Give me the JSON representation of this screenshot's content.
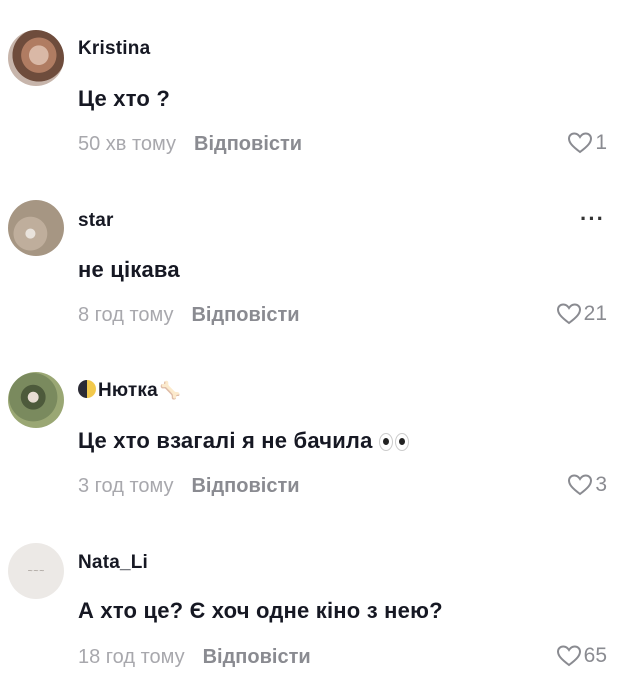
{
  "comments": [
    {
      "username": "Kristina",
      "text": "Це хто ?",
      "time": "50 хв тому",
      "reply": "Відповісти",
      "likes": "1",
      "avatar_icon": "user-photo-avatar"
    },
    {
      "username": "star",
      "text": "не цікава",
      "time": "8 год тому",
      "reply": "Відповісти",
      "likes": "21",
      "more": "···",
      "avatar_icon": "heart-shells-avatar"
    },
    {
      "username": "Нютка",
      "text": "Це хто взагалі я не бачила",
      "time": "3 год тому",
      "reply": "Відповісти",
      "likes": "3",
      "emoji_prefix": "moon-icon",
      "emoji_suffix": "bone-icon",
      "text_emoji": "eyes-icon",
      "avatar_icon": "user-photo-avatar"
    },
    {
      "username": "Nata_Li",
      "text": "А хто це? Є хоч одне кіно з нею?",
      "time": "18 год тому",
      "reply": "Відповісти",
      "likes": "65",
      "avatar_icon": "signature-logo-avatar"
    }
  ],
  "colors": {
    "text": "#161823",
    "meta": "#a8a8ad",
    "reply": "#8a8b91",
    "like_icon": "#8a8b91"
  }
}
